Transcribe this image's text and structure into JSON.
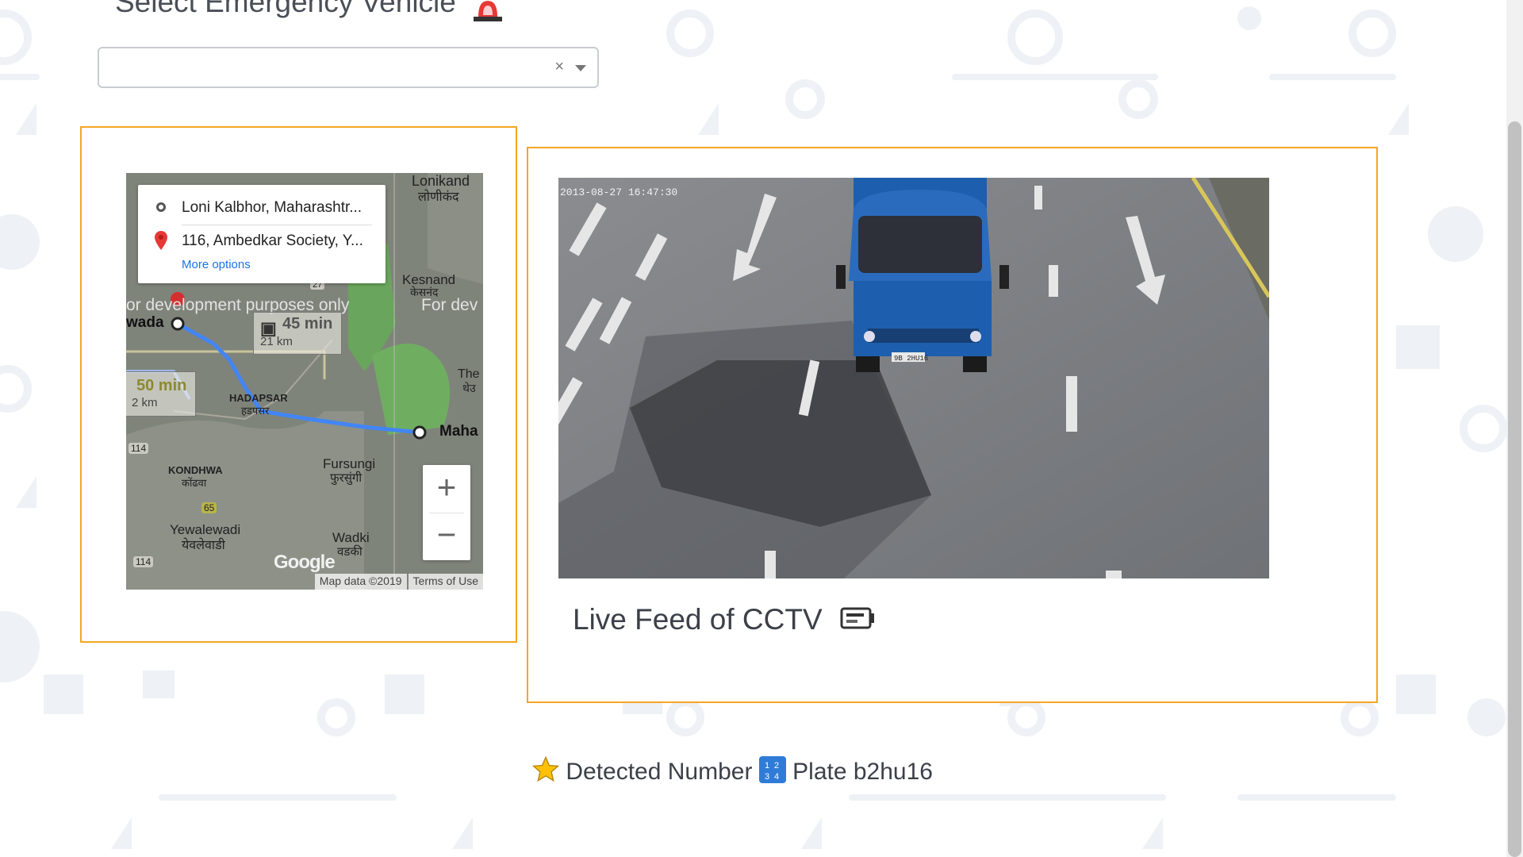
{
  "header": {
    "title": "Select Emergency Vehicle",
    "siren_icon": "police-siren-icon"
  },
  "vehicle_select": {
    "value": "",
    "clear_symbol": "×",
    "caret_icon": "chevron-down-icon"
  },
  "map": {
    "origin": "Loni Kalbhor, Maharashtr...",
    "destination": "116, Ambedkar Society, Y...",
    "more_options": "More options",
    "route_primary_time": "45 min",
    "route_primary_distance": "21 km",
    "route_alt_time": "50 min",
    "route_alt_distance": "2 km",
    "watermark": "or development purposes only",
    "watermark_right": "For dev",
    "place_labels": {
      "lonikand": "Lonikand",
      "lonikand_local": "लोणीकंद",
      "kesnand": "Kesnand",
      "kesnand_local": "केसनंद",
      "wada": "wada",
      "hadapsar": "HADAPSAR",
      "hadapsar_local": "हडपसर",
      "kondhwa": "KONDHWA",
      "kondhwa_local": "कोंढवा",
      "fursungi": "Fursungi",
      "fursungi_local": "फुरसुंगी",
      "yewalewadi": "Yewalewadi",
      "yewalewadi_local": "येवलेवाडी",
      "wadki": "Wadki",
      "wadki_local": "वडकी",
      "maha": "Maha",
      "the": "The",
      "the_local": "थेउ"
    },
    "road_shields": [
      "27",
      "114",
      "65",
      "114"
    ],
    "zoom_in": "+",
    "zoom_out": "−",
    "logo": "Google",
    "map_data": "Map data ©2019",
    "terms": "Terms of Use"
  },
  "cctv": {
    "timestamp": "2013-08-27 16:47:30",
    "plate_on_image": "9B 2HU16",
    "title": "Live Feed of CCTV",
    "camera_icon": "video-camera-icon"
  },
  "detection": {
    "star_icon": "star-icon",
    "label": "Detected Number",
    "numbers_icon": "input-numbers-icon",
    "plate_text": "Plate b2hu16"
  },
  "colors": {
    "card_border": "#f5a623",
    "link": "#1a73e8",
    "route": "#4285f4"
  }
}
